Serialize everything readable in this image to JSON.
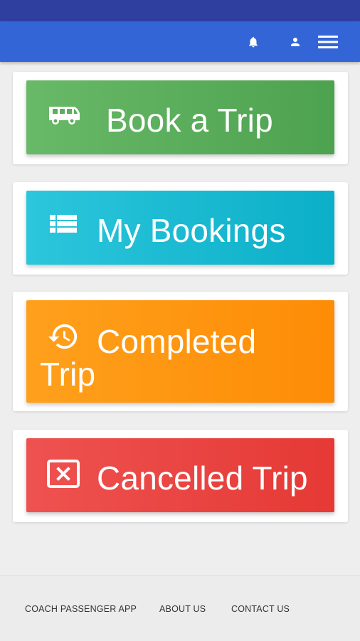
{
  "header": {
    "icons": [
      "bell-icon",
      "person-icon",
      "hamburger-menu-icon"
    ],
    "colors": {
      "status_bar": "#2f3fa0",
      "app_bar": "#3365d6"
    }
  },
  "tiles": [
    {
      "label": "Book a Trip",
      "icon": "bus-icon",
      "color": "#57ab58"
    },
    {
      "label": "My Bookings",
      "icon": "list-icon",
      "color": "#17b9d0"
    },
    {
      "label": "Completed Trip",
      "icon": "history-icon",
      "color": "#fe9610"
    },
    {
      "label": "Cancelled Trip",
      "icon": "cancel-box-icon",
      "color": "#e84340"
    }
  ],
  "footer": {
    "links": [
      "COACH PASSENGER APP",
      "ABOUT US",
      "CONTACT US"
    ]
  }
}
